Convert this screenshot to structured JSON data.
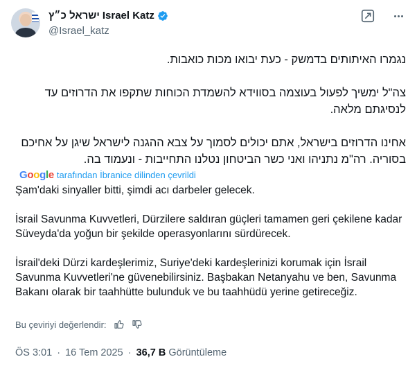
{
  "author": {
    "display_name_hebrew": "ישראל כ״ץ",
    "display_name_latin": "Israel Katz",
    "handle": "@Israel_katz"
  },
  "tweet": {
    "hebrew_paragraphs": [
      "נגמרו האיתותים בדמשק - כעת יבואו מכות כואבות.",
      "צה\"ל ימשיך לפעול בעוצמה בסווידא להשמדת הכוחות שתקפו את הדרוזים עד לנסיגתם מלאה.",
      "אחינו הדרוזים בישראל, אתם יכולים לסמוך על צבא ההגנה לישראל שיגן על אחיכם בסוריה. רה\"מ נתניהו ואני כשר הביטחון נטלנו התחייבות - ונעמוד בה."
    ],
    "translation_label": "tarafından İbranice dilinden çevrildi",
    "translation_provider": "Google",
    "translated_paragraphs": [
      "Şam'daki sinyaller bitti, şimdi acı darbeler gelecek.",
      "İsrail Savunma Kuvvetleri, Dürzilere saldıran güçleri tamamen geri çekilene kadar Süveyda'da yoğun bir şekilde operasyonlarını sürdürecek.",
      "İsrail'deki Dürzi kardeşlerimiz, Suriye'deki kardeşlerinizi korumak için İsrail Savunma Kuvvetleri'ne güvenebilirsiniz. Başbakan Netanyahu ve ben, Savunma Bakanı olarak bir taahhütte bulunduk ve bu taahhüdü yerine getireceğiz."
    ],
    "rate_prompt": "Bu çeviriyi değerlendir:",
    "time": "ÖS 3:01",
    "separator": "·",
    "date": "16 Tem 2025",
    "views_count": "36,7 B",
    "views_label": "Görüntüleme"
  },
  "icons": {
    "verified": "verified-badge-icon",
    "grok": "grok-icon",
    "more": "more-icon",
    "thumbs_up": "thumbs-up-icon",
    "thumbs_down": "thumbs-down-icon"
  },
  "colors": {
    "accent": "#1d9bf0",
    "text": "#0f1419",
    "muted": "#536471"
  }
}
